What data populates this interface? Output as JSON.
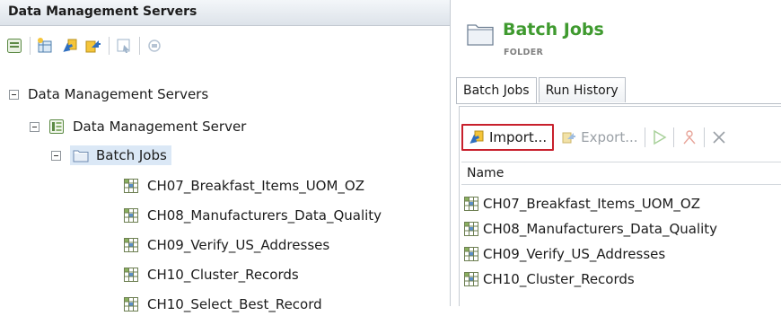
{
  "left_panel": {
    "header": "Data Management Servers",
    "toolbar_icons": [
      "new-server-icon",
      "new-job-icon",
      "import-icon",
      "export-icon",
      "select-icon",
      "disconnect-icon"
    ],
    "tree": {
      "root": "Data Management Servers",
      "server": "Data Management Server",
      "folder": "Batch Jobs",
      "jobs": [
        "CH07_Breakfast_Items_UOM_OZ",
        "CH08_Manufacturers_Data_Quality",
        "CH09_Verify_US_Addresses",
        "CH10_Cluster_Records",
        "CH10_Select_Best_Record"
      ]
    }
  },
  "right_panel": {
    "title": "Batch Jobs",
    "subtitle": "FOLDER",
    "tabs": [
      "Batch Jobs",
      "Run History"
    ],
    "toolbar": {
      "import_label": "Import...",
      "export_label": "Export..."
    },
    "grid": {
      "column_header": "Name",
      "rows": [
        "CH07_Breakfast_Items_UOM_OZ",
        "CH08_Manufacturers_Data_Quality",
        "CH09_Verify_US_Addresses",
        "CH10_Cluster_Records"
      ]
    }
  },
  "colors": {
    "title_green": "#3f9a2f",
    "highlight_red": "#c8202c",
    "selection_blue": "#dbe8f6"
  }
}
